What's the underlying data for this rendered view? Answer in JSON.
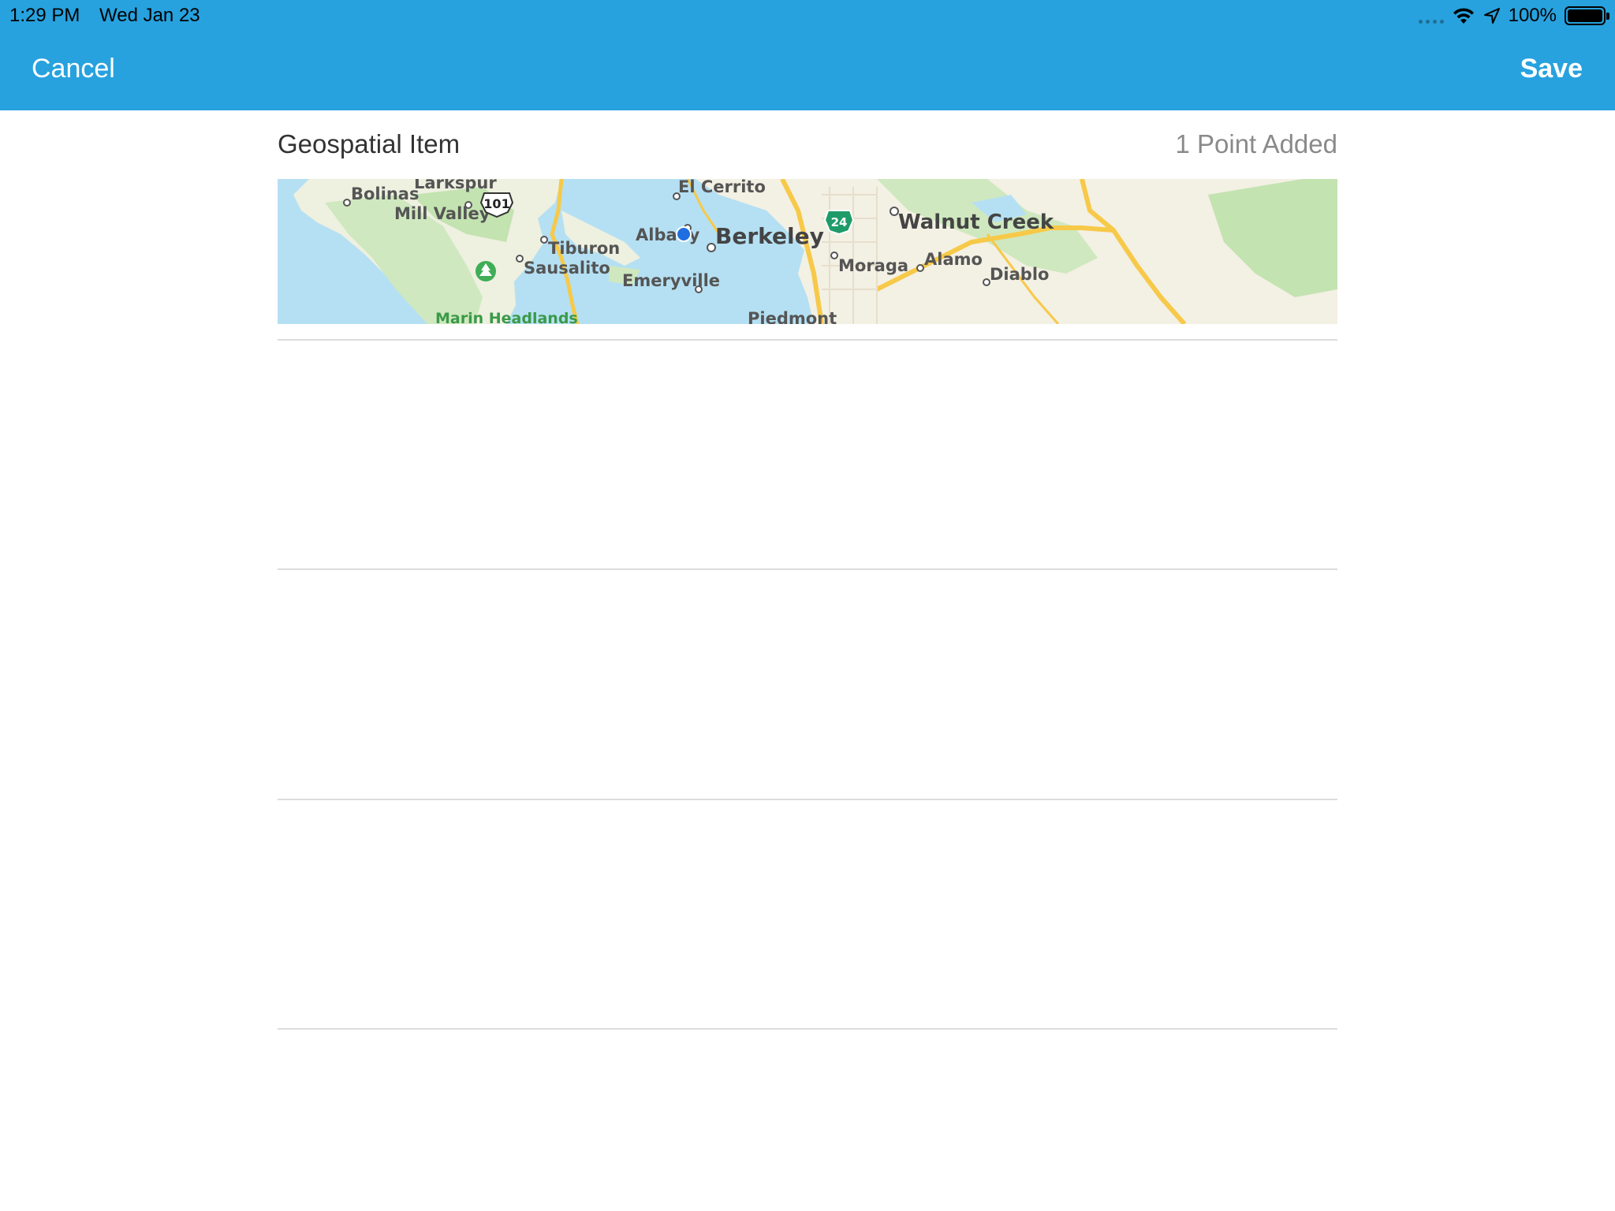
{
  "status_bar": {
    "time": "1:29 PM",
    "date": "Wed Jan 23",
    "battery": "100%",
    "icons": [
      "signal-dots-icon",
      "wifi-icon",
      "location-arrow-icon",
      "battery-icon"
    ]
  },
  "nav": {
    "cancel_label": "Cancel",
    "save_label": "Save"
  },
  "item": {
    "title": "Geospatial Item",
    "count_label": "1 Point Added"
  },
  "map": {
    "labels": {
      "bolinas": "Bolinas",
      "larkspur": "Larkspur",
      "mill_valley": "Mill Valley",
      "tiburon": "Tiburon",
      "sausalito": "Sausalito",
      "marin_headlands": "Marin Headlands",
      "el_cerrito": "El Cerrito",
      "albany": "Albany",
      "berkeley": "Berkeley",
      "emeryville": "Emeryville",
      "piedmont": "Piedmont",
      "walnut_creek": "Walnut Creek",
      "moraga": "Moraga",
      "alamo": "Alamo",
      "diablo": "Diablo"
    },
    "shields": {
      "us_101": "101",
      "ca_24": "24"
    },
    "colors": {
      "water": "#b5e0f3",
      "land": "#f3f0e4",
      "park": "#c9e6b9",
      "highway": "#f7c948",
      "pin": "#1f6fe0"
    }
  },
  "rows": [
    {
      "id": "row-1"
    },
    {
      "id": "row-2"
    },
    {
      "id": "row-3"
    }
  ]
}
